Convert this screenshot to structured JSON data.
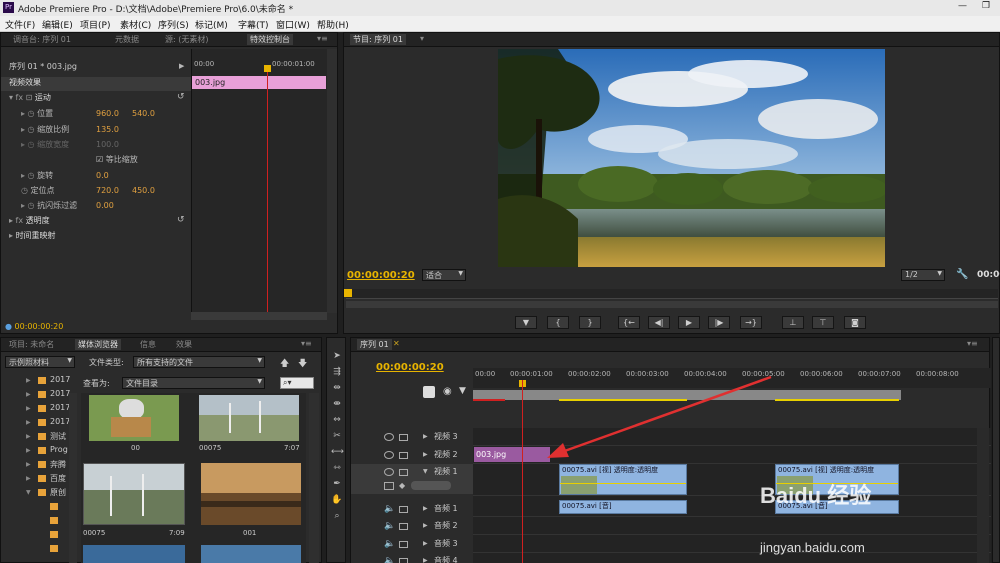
{
  "app": {
    "title": "Adobe Premiere Pro - D:\\文档\\Adobe\\Premiere Pro\\6.0\\未命名 *",
    "logo": "Pr"
  },
  "menu": [
    "文件(F)",
    "编辑(E)",
    "项目(P)",
    "素材(C)",
    "序列(S)",
    "标记(M)",
    "字幕(T)",
    "窗口(W)",
    "帮助(H)"
  ],
  "effect_panel": {
    "tabs": [
      "调音台: 序列 01",
      "元数据",
      "源: (无素材)",
      "特效控制台"
    ],
    "clip_title": "序列 01 * 003.jpg",
    "section": "视频效果",
    "ruler_start": "00:00",
    "ruler_mid": "00:00:01:00",
    "clip_name": "003.jpg",
    "motion": "运动",
    "position_label": "位置",
    "position_x": "960.0",
    "position_y": "540.0",
    "scale_label": "缩放比例",
    "scale_value": "135.0",
    "scale_width_label": "缩放宽度",
    "scale_width_value": "100.0",
    "uniform_scale": "等比缩放",
    "rotation_label": "旋转",
    "rotation_value": "0.0",
    "anchor_label": "定位点",
    "anchor_x": "720.0",
    "anchor_y": "450.0",
    "flicker_label": "抗闪烁过滤",
    "flicker_value": "0.00",
    "opacity": "透明度",
    "time_remap": "时间重映射",
    "timecode": "00:00:00:20"
  },
  "program_monitor": {
    "tab": "节目: 序列 01",
    "timecode": "00:00:00:20",
    "fit": "适合",
    "resolution": "1/2",
    "right_timecode": "00:00"
  },
  "project_panel": {
    "tabs": [
      "项目: 未命名",
      "媒体浏览器",
      "信息",
      "效果"
    ],
    "source_select": "示例照材料",
    "file_type_label": "文件类型:",
    "file_type_value": "所有支持的文件",
    "view_as_label": "查看为:",
    "view_as_value": "文件目录",
    "folders": [
      "2017",
      "2017",
      "2017",
      "2017",
      "测试",
      "Prog",
      "奔腾",
      "百度",
      "原创"
    ],
    "thumbs": [
      {
        "name": "00",
        "duration": ""
      },
      {
        "name": "00075",
        "duration": "7:07"
      },
      {
        "name": "00075",
        "duration": "7:09"
      },
      {
        "name": "001",
        "duration": ""
      }
    ]
  },
  "timeline": {
    "tab": "序列 01",
    "timecode": "00:00:00:20",
    "ruler": [
      "00:00",
      "00:00:01:00",
      "00:00:02:00",
      "00:00:03:00",
      "00:00:04:00",
      "00:00:05:00",
      "00:00:06:00",
      "00:00:07:00",
      "00:00:08:00"
    ],
    "tracks": {
      "v3": "视频 3",
      "v2": "视频 2",
      "v1": "视频 1",
      "a1": "音频 1",
      "a2": "音频 2",
      "a3": "音频 3",
      "a4": "音频 4"
    },
    "clip_v2": "003.jpg",
    "clip_v1a": "00075.avi [视] 透明度:透明度",
    "clip_v1b": "00075.avi [视] 透明度:透明度",
    "clip_a1a": "00075.avi [音]",
    "clip_a1b": "00075.avi [音]"
  },
  "watermark": {
    "brand": "Baidu 经验",
    "url": "jingyan.baidu.com"
  },
  "colors": {
    "accent_timecode": "#e8b400",
    "clip_pink": "#e8a0d8",
    "clip_purple": "#9a5aa0",
    "clip_blue": "#8fb4e0",
    "playhead": "#d02020",
    "arrow": "#e03030"
  }
}
